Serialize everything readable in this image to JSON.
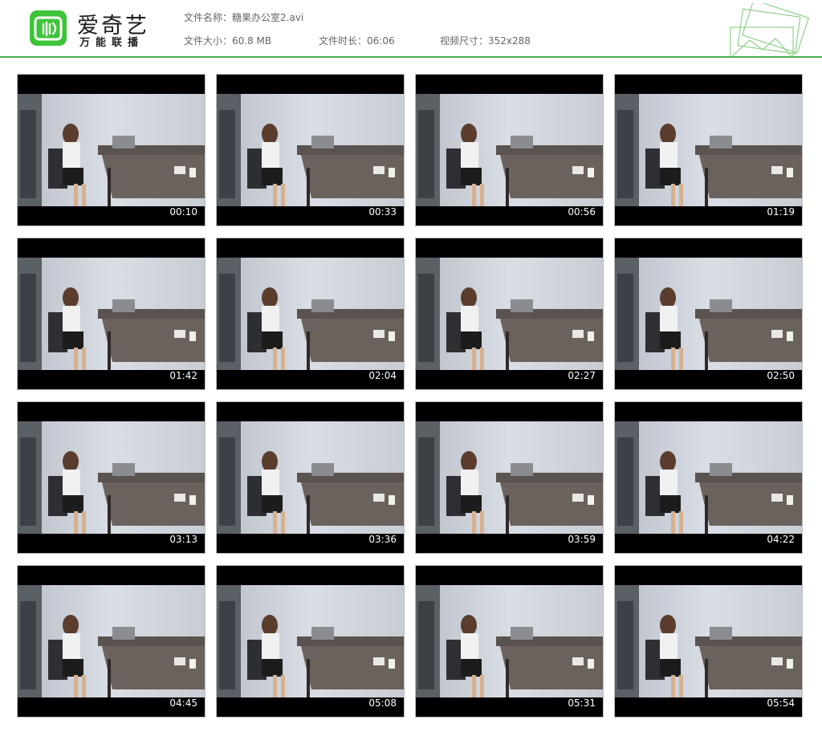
{
  "brand": {
    "name": "爱奇艺",
    "subtitle": "万能联播",
    "logo_color": "#3ec43a",
    "logo_icon": "iqiyi-tv-icon"
  },
  "file_info": {
    "name_label": "文件名称：",
    "name_value": "糖果办公室2.avi",
    "size_label": "文件大小：",
    "size_value": "60.8 MB",
    "duration_label": "文件时长：",
    "duration_value": "06:06",
    "resolution_label": "视频尺寸：",
    "resolution_value": "352x288"
  },
  "accent_color": "#4caf50",
  "thumbnails": [
    {
      "time": "00:10"
    },
    {
      "time": "00:33"
    },
    {
      "time": "00:56"
    },
    {
      "time": "01:19"
    },
    {
      "time": "01:42"
    },
    {
      "time": "02:04"
    },
    {
      "time": "02:27"
    },
    {
      "time": "02:50"
    },
    {
      "time": "03:13"
    },
    {
      "time": "03:36"
    },
    {
      "time": "03:59"
    },
    {
      "time": "04:22"
    },
    {
      "time": "04:45"
    },
    {
      "time": "05:08"
    },
    {
      "time": "05:31"
    },
    {
      "time": "05:54"
    }
  ]
}
